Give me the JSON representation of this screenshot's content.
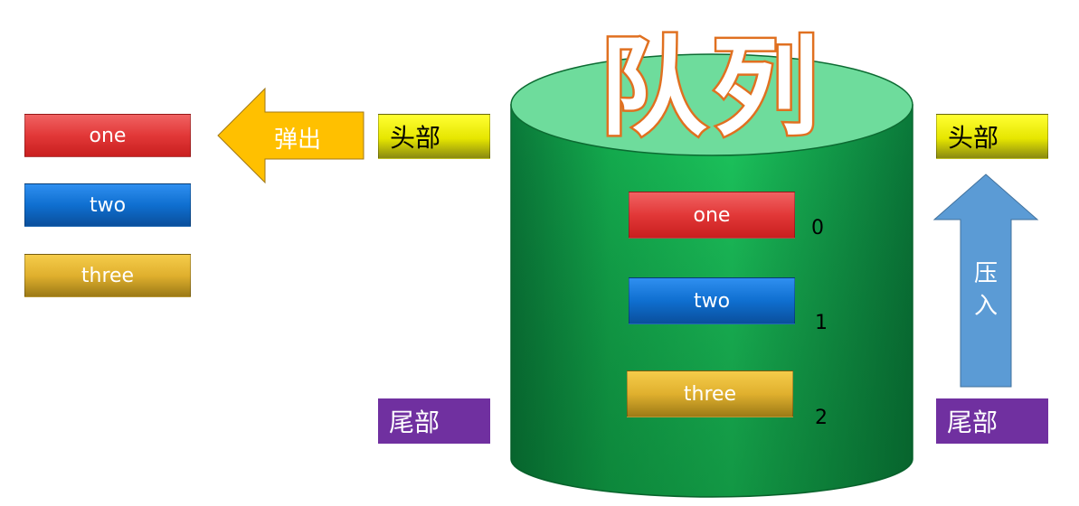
{
  "title": "队列",
  "left_list": [
    "one",
    "two",
    "three"
  ],
  "pop_label": "弹出",
  "left_head_label": "头部",
  "left_tail_label": "尾部",
  "queue_items": [
    {
      "label": "one",
      "index": "0"
    },
    {
      "label": "two",
      "index": "1"
    },
    {
      "label": "three",
      "index": "2"
    }
  ],
  "right_head_label": "头部",
  "right_tail_label": "尾部",
  "push_label_line1": "压",
  "push_label_line2": "入",
  "colors": {
    "red": "#e23838",
    "blue": "#0f6fd0",
    "gold": "#e0b02e",
    "cylinder_green": "#14b050",
    "cylinder_top": "#6edc9c",
    "pop_arrow": "#ffc000",
    "push_arrow": "#5b9bd5",
    "head_yellow": "#e6e600",
    "tail_purple": "#7030a0",
    "title_orange": "#f08a3a"
  }
}
